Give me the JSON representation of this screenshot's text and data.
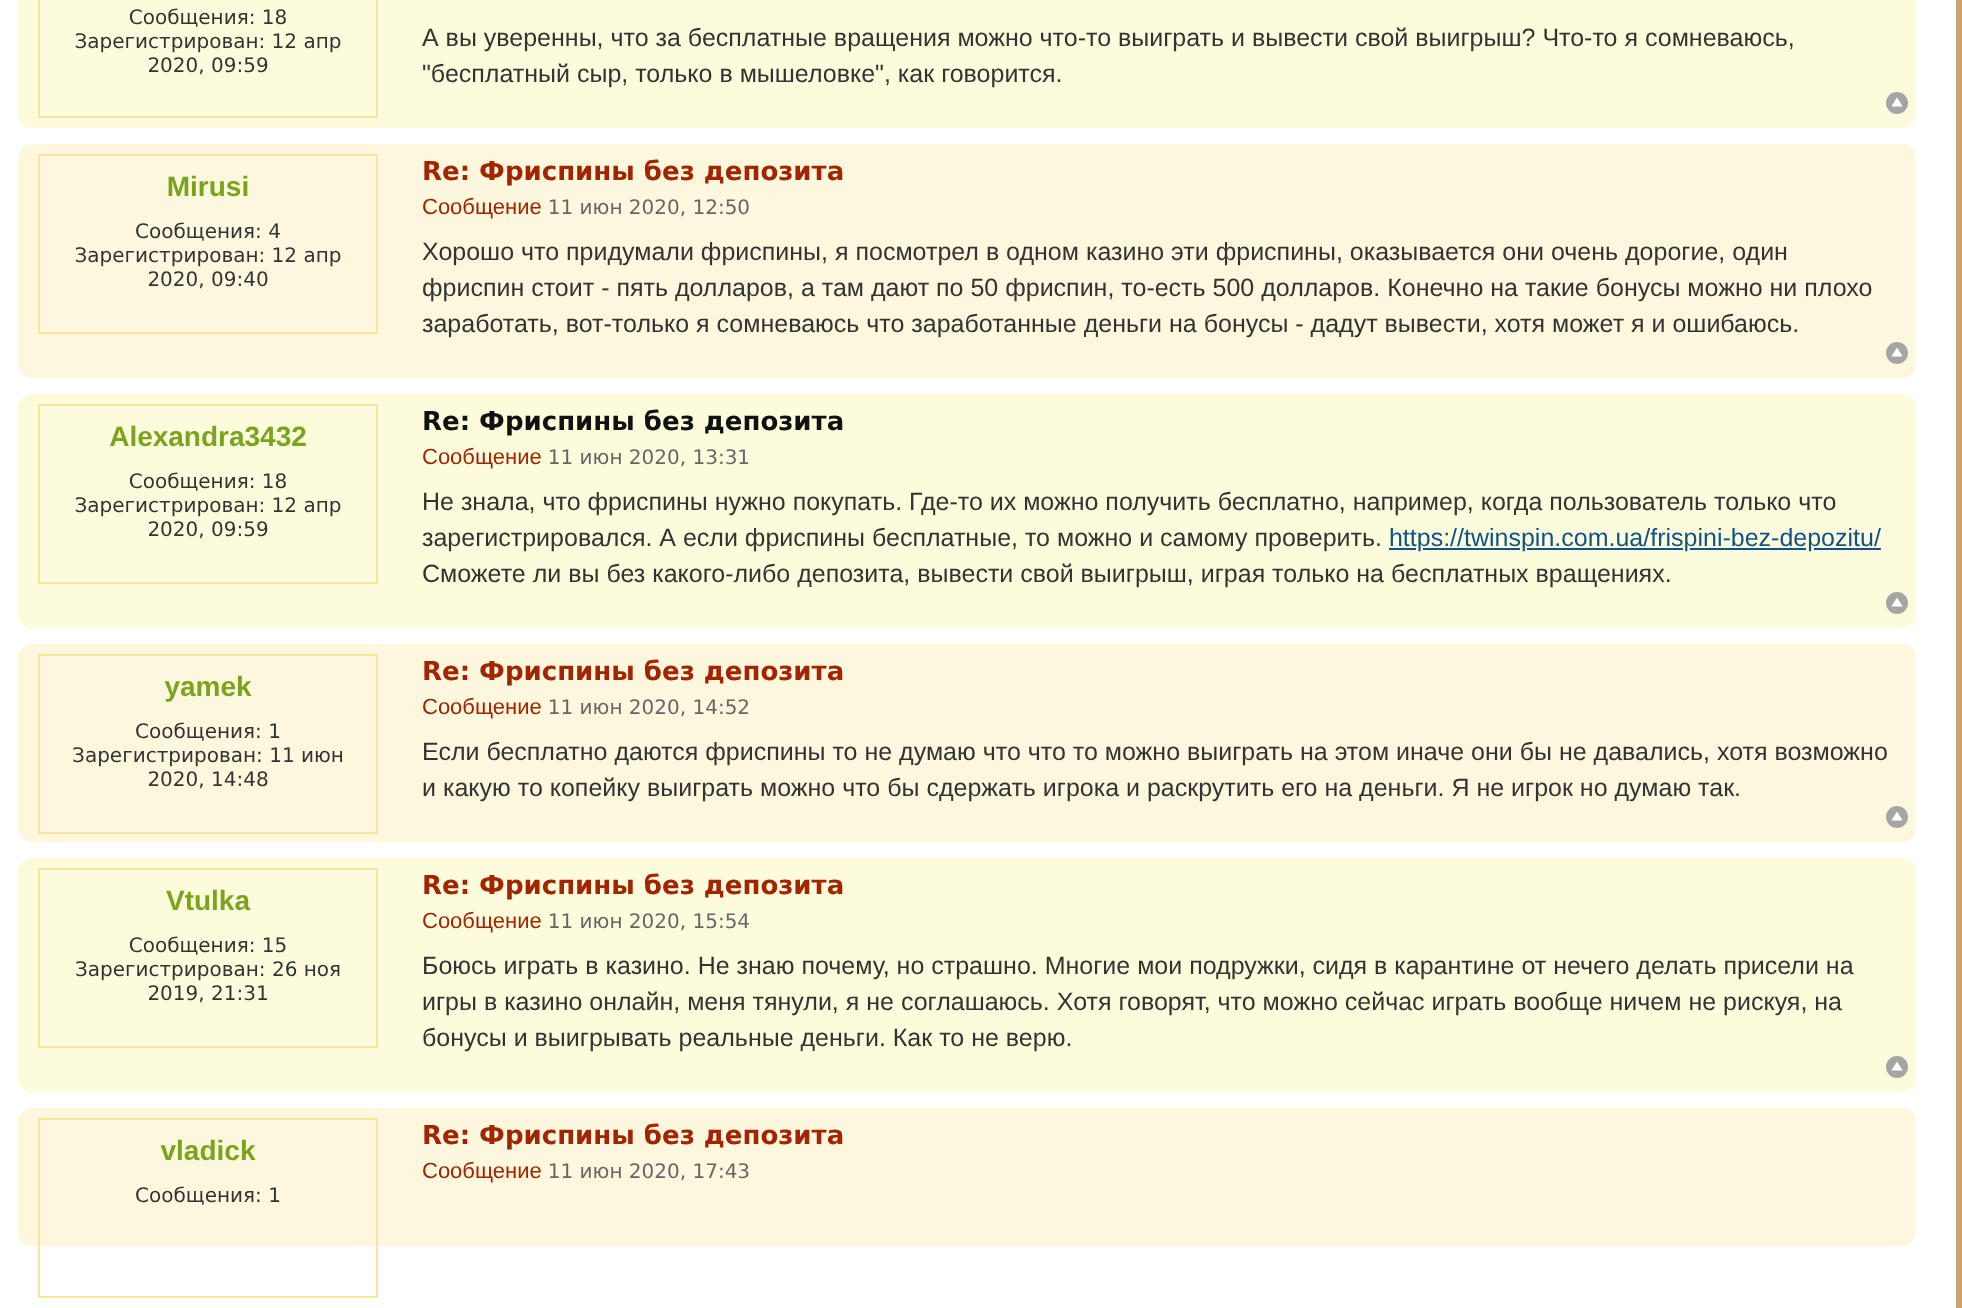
{
  "posts": [
    {
      "posts_count": "Сообщения: 18",
      "registered": "Зарегистрирован: 12 апр 2020, 09:59",
      "body": [
        {
          "text": "А вы уверенны, что за бесплатные вращения можно что-то выиграть и вывести свой выигрыш? Что-то я сомневаюсь, \"бесплатный сыр, только в мышеловке\", как говорится."
        }
      ]
    },
    {
      "username": "Mirusi",
      "posts_count": "Сообщения: 4",
      "registered": "Зарегистрирован: 12 апр 2020, 09:40",
      "title": "Re: Фриспины без депозита",
      "meta_label": "Сообщение",
      "date": "11 июн 2020, 12:50",
      "hovered": false,
      "body": [
        {
          "text": "Хорошо что придумали фриспины, я посмотрел в одном казино эти фриспины, оказывается они очень дорогие, один фриспин стоит - пять долларов, а там дают по 50 фриспин, то-есть 500 долларов. Конечно на такие бонусы можно ни плохо заработать, вот-только я сомневаюсь что заработанные деньги на бонусы - дадут вывести, хотя может я и ошибаюсь."
        }
      ]
    },
    {
      "username": "Alexandra3432",
      "posts_count": "Сообщения: 18",
      "registered": "Зарегистрирован: 12 апр 2020, 09:59",
      "title": "Re: Фриспины без депозита",
      "meta_label": "Сообщение",
      "date": "11 июн 2020, 13:31",
      "hovered": true,
      "body": [
        {
          "text": "Не знала, что фриспины нужно покупать. Где-то их можно получить бесплатно, например, когда пользователь только что зарегистрировался. А если фриспины бесплатные, то можно и самому проверить. "
        },
        {
          "link": "https://twinspin.com.ua/frispini-bez-depozitu/"
        },
        {
          "text": " Сможете ли вы без какого-либо депозита, вывести свой выигрыш, играя только на бесплатных вращениях."
        }
      ]
    },
    {
      "username": "yamek",
      "posts_count": "Сообщения: 1",
      "registered": "Зарегистрирован: 11 июн 2020, 14:48",
      "title": "Re: Фриспины без депозита",
      "meta_label": "Сообщение",
      "date": "11 июн 2020, 14:52",
      "hovered": false,
      "body": [
        {
          "text": "Если бесплатно даются фриспины то не думаю что что то можно выиграть на этом иначе они бы не давались, хотя возможно и какую то копейку выиграть можно что бы сдержать игрока и раскрутить его на деньги. Я не игрок но думаю так."
        }
      ]
    },
    {
      "username": "Vtulka",
      "posts_count": "Сообщения: 15",
      "registered": "Зарегистрирован: 26 ноя 2019, 21:31",
      "title": "Re: Фриспины без депозита",
      "meta_label": "Сообщение",
      "date": "11 июн 2020, 15:54",
      "hovered": false,
      "body": [
        {
          "text": "Боюсь играть в казино. Не знаю почему, но страшно. Многие мои подружки, сидя в карантине от нечего делать присели на игры в казино онлайн, меня тянули, я не соглашаюсь. Хотя говорят, что можно сейчас играть вообще ничем не рискуя, на бонусы и выигрывать реальные деньги. Как то не верю."
        }
      ]
    },
    {
      "username": "vladick",
      "posts_count": "Сообщения: 1",
      "title": "Re: Фриспины без депозита",
      "meta_label": "Сообщение",
      "date": "11 июн 2020, 17:43",
      "hovered": false
    }
  ]
}
